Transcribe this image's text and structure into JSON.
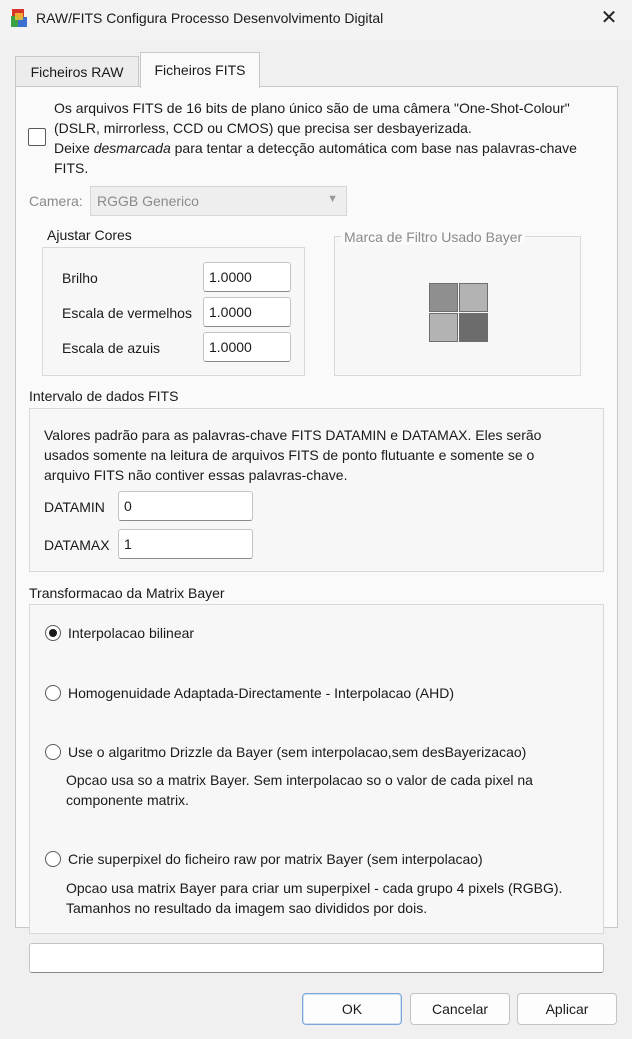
{
  "window": {
    "title": "RAW/FITS Configura Processo Desenvolvimento Digital",
    "close_glyph": "✕"
  },
  "tabs": [
    {
      "label": "Ficheiros RAW",
      "active": false
    },
    {
      "label": "Ficheiros FITS",
      "active": true
    }
  ],
  "one_shot": {
    "checked": false,
    "line1": "Os arquivos FITS de 16 bits de plano único são de uma câmera \"One-Shot-Colour\"",
    "line2": "(DSLR, mirrorless, CCD ou CMOS) que precisa ser desbayerizada.",
    "line3_prefix": "Deixe ",
    "line3_emphasis": "desmarcada",
    "line3_suffix": " para tentar a detecção automática com base nas palavras-chave",
    "line4": "FITS."
  },
  "camera": {
    "label": "Camera:",
    "value": "RGGB Generico"
  },
  "ajustar_cores": {
    "title": "Ajustar Cores",
    "brilho_label": "Brilho",
    "brilho_value": "1.0000",
    "vermelhos_label": "Escala de vermelhos",
    "vermelhos_value": "1.0000",
    "azuis_label": "Escala de azuis",
    "azuis_value": "1.0000"
  },
  "marca_filtro": {
    "title": "Marca de Filtro Usado Bayer",
    "cell_colors": [
      "#8f8f8f",
      "#b3b3b3",
      "#b3b3b3",
      "#6c6c6c"
    ]
  },
  "fits_range": {
    "title": "Intervalo de dados FITS",
    "desc1": "Valores padrão para as palavras-chave FITS DATAMIN e DATAMAX. Eles serão",
    "desc2": "usados somente na leitura de arquivos FITS de ponto flutuante e somente se o",
    "desc3": "arquivo FITS não contiver essas palavras-chave.",
    "datamin_label": "DATAMIN",
    "datamin_value": "0",
    "datamax_label": "DATAMAX",
    "datamax_value": "1"
  },
  "bayer_transform": {
    "title": "Transformacao da Matrix Bayer",
    "options": [
      {
        "label": "Interpolacao bilinear",
        "checked": true
      },
      {
        "label": "Homogenuidade Adaptada-Directamente - Interpolacao (AHD)",
        "checked": false
      },
      {
        "label": "Use o algaritmo Drizzle da Bayer (sem interpolacao,sem desBayerizacao)",
        "checked": false,
        "desc1": "Opcao usa so a matrix Bayer. Sem interpolacao so o valor de cada pixel na",
        "desc2": "componente matrix."
      },
      {
        "label": "Crie superpixel do ficheiro raw por matrix Bayer (sem interpolacao)",
        "checked": false,
        "desc1": "Opcao usa matrix Bayer para criar um superpixel - cada grupo 4 pixels (RGBG).",
        "desc2": "Tamanhos no resultado da imagem sao divididos por dois."
      }
    ]
  },
  "status_field": {
    "value": ""
  },
  "buttons": {
    "ok": "OK",
    "cancel": "Cancelar",
    "apply": "Aplicar"
  }
}
